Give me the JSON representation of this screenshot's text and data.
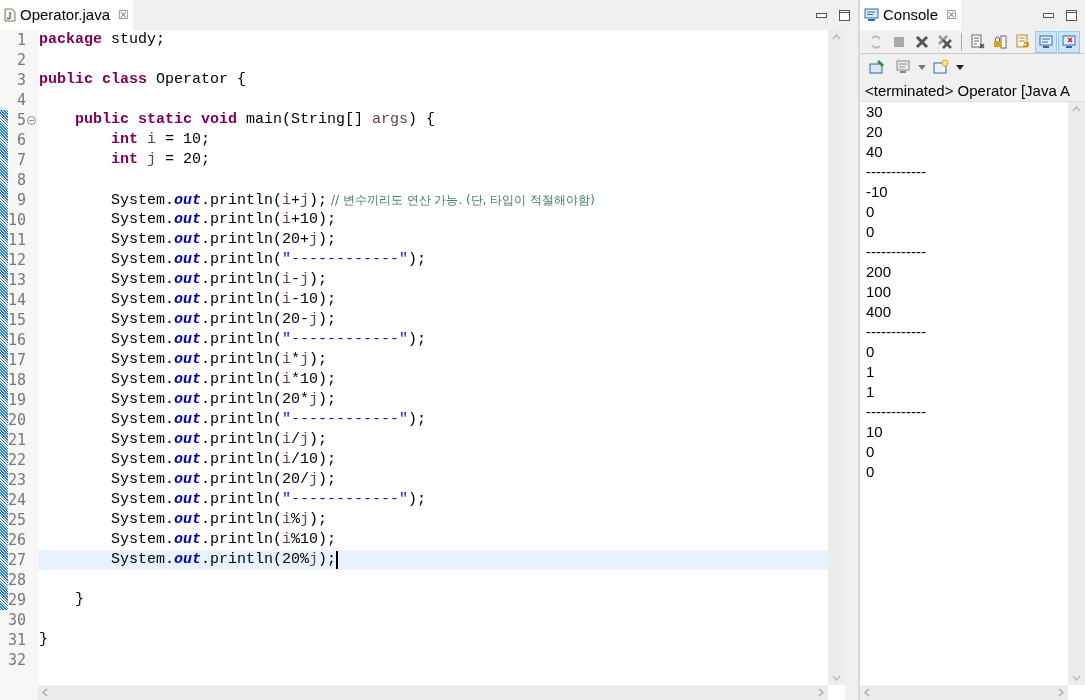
{
  "editor": {
    "tab": {
      "title": "Operator.java",
      "close": "☒",
      "selected": true
    },
    "lines": [
      {
        "number": "1",
        "changed": false,
        "current": false,
        "fold": false,
        "tokens": [
          {
            "kind": "keyword",
            "text": "package"
          },
          {
            "kind": "plain",
            "text": " study;"
          }
        ]
      },
      {
        "number": "2",
        "changed": false,
        "current": false,
        "fold": false
      },
      {
        "number": "3",
        "changed": false,
        "current": false,
        "fold": false,
        "tokens": [
          {
            "kind": "keyword",
            "text": "public class"
          },
          {
            "kind": "plain",
            "text": " Operator {"
          }
        ]
      },
      {
        "number": "4",
        "changed": false,
        "current": false,
        "fold": false
      },
      {
        "number": "5",
        "changed": true,
        "current": false,
        "fold": true,
        "tokens": [
          {
            "kind": "keyword",
            "text": "    public static void"
          },
          {
            "kind": "plain",
            "text": " main(String[] "
          },
          {
            "kind": "variable",
            "text": "args"
          },
          {
            "kind": "plain",
            "text": ") {"
          }
        ]
      },
      {
        "number": "6",
        "changed": true,
        "current": false,
        "fold": false,
        "tokens": [
          {
            "kind": "keyword",
            "text": "        int"
          },
          {
            "kind": "variable",
            "text": " i"
          },
          {
            "kind": "plain",
            "text": " = 10;"
          }
        ]
      },
      {
        "number": "7",
        "changed": true,
        "current": false,
        "fold": false,
        "tokens": [
          {
            "kind": "keyword",
            "text": "        int"
          },
          {
            "kind": "variable",
            "text": " j"
          },
          {
            "kind": "plain",
            "text": " = 20;"
          }
        ]
      },
      {
        "number": "8",
        "changed": true,
        "current": false,
        "fold": false
      },
      {
        "number": "9",
        "changed": true,
        "current": false,
        "fold": false,
        "tokens": [
          {
            "kind": "plain",
            "text": "        System."
          },
          {
            "kind": "field",
            "text": "out"
          },
          {
            "kind": "plain",
            "text": ".println("
          },
          {
            "kind": "variable",
            "text": "i"
          },
          {
            "kind": "plain",
            "text": "+"
          },
          {
            "kind": "variable",
            "text": "j"
          },
          {
            "kind": "plain",
            "text": ");"
          },
          {
            "kind": "comment",
            "text": " // 변수끼리도 연산 가능. (단, 타입이 적절해야함)"
          }
        ]
      },
      {
        "number": "10",
        "changed": true,
        "current": false,
        "fold": false,
        "tokens": [
          {
            "kind": "plain",
            "text": "        System."
          },
          {
            "kind": "field",
            "text": "out"
          },
          {
            "kind": "plain",
            "text": ".println("
          },
          {
            "kind": "variable",
            "text": "i"
          },
          {
            "kind": "plain",
            "text": "+10);"
          }
        ]
      },
      {
        "number": "11",
        "changed": true,
        "current": false,
        "fold": false,
        "tokens": [
          {
            "kind": "plain",
            "text": "        System."
          },
          {
            "kind": "field",
            "text": "out"
          },
          {
            "kind": "plain",
            "text": ".println(20+"
          },
          {
            "kind": "variable",
            "text": "j"
          },
          {
            "kind": "plain",
            "text": ");"
          }
        ]
      },
      {
        "number": "12",
        "changed": true,
        "current": false,
        "fold": false,
        "tokens": [
          {
            "kind": "plain",
            "text": "        System."
          },
          {
            "kind": "field",
            "text": "out"
          },
          {
            "kind": "plain",
            "text": ".println("
          },
          {
            "kind": "string",
            "text": "\"------------\""
          },
          {
            "kind": "plain",
            "text": ");"
          }
        ]
      },
      {
        "number": "13",
        "changed": true,
        "current": false,
        "fold": false,
        "tokens": [
          {
            "kind": "plain",
            "text": "        System."
          },
          {
            "kind": "field",
            "text": "out"
          },
          {
            "kind": "plain",
            "text": ".println("
          },
          {
            "kind": "variable",
            "text": "i"
          },
          {
            "kind": "plain",
            "text": "-"
          },
          {
            "kind": "variable",
            "text": "j"
          },
          {
            "kind": "plain",
            "text": ");"
          }
        ]
      },
      {
        "number": "14",
        "changed": true,
        "current": false,
        "fold": false,
        "tokens": [
          {
            "kind": "plain",
            "text": "        System."
          },
          {
            "kind": "field",
            "text": "out"
          },
          {
            "kind": "plain",
            "text": ".println("
          },
          {
            "kind": "variable",
            "text": "i"
          },
          {
            "kind": "plain",
            "text": "-10);"
          }
        ]
      },
      {
        "number": "15",
        "changed": true,
        "current": false,
        "fold": false,
        "tokens": [
          {
            "kind": "plain",
            "text": "        System."
          },
          {
            "kind": "field",
            "text": "out"
          },
          {
            "kind": "plain",
            "text": ".println(20-"
          },
          {
            "kind": "variable",
            "text": "j"
          },
          {
            "kind": "plain",
            "text": ");"
          }
        ]
      },
      {
        "number": "16",
        "changed": true,
        "current": false,
        "fold": false,
        "tokens": [
          {
            "kind": "plain",
            "text": "        System."
          },
          {
            "kind": "field",
            "text": "out"
          },
          {
            "kind": "plain",
            "text": ".println("
          },
          {
            "kind": "string",
            "text": "\"------------\""
          },
          {
            "kind": "plain",
            "text": ");"
          }
        ]
      },
      {
        "number": "17",
        "changed": true,
        "current": false,
        "fold": false,
        "tokens": [
          {
            "kind": "plain",
            "text": "        System."
          },
          {
            "kind": "field",
            "text": "out"
          },
          {
            "kind": "plain",
            "text": ".println("
          },
          {
            "kind": "variable",
            "text": "i"
          },
          {
            "kind": "plain",
            "text": "*"
          },
          {
            "kind": "variable",
            "text": "j"
          },
          {
            "kind": "plain",
            "text": ");"
          }
        ]
      },
      {
        "number": "18",
        "changed": true,
        "current": false,
        "fold": false,
        "tokens": [
          {
            "kind": "plain",
            "text": "        System."
          },
          {
            "kind": "field",
            "text": "out"
          },
          {
            "kind": "plain",
            "text": ".println("
          },
          {
            "kind": "variable",
            "text": "i"
          },
          {
            "kind": "plain",
            "text": "*10);"
          }
        ]
      },
      {
        "number": "19",
        "changed": true,
        "current": false,
        "fold": false,
        "tokens": [
          {
            "kind": "plain",
            "text": "        System."
          },
          {
            "kind": "field",
            "text": "out"
          },
          {
            "kind": "plain",
            "text": ".println(20*"
          },
          {
            "kind": "variable",
            "text": "j"
          },
          {
            "kind": "plain",
            "text": ");"
          }
        ]
      },
      {
        "number": "20",
        "changed": true,
        "current": false,
        "fold": false,
        "tokens": [
          {
            "kind": "plain",
            "text": "        System."
          },
          {
            "kind": "field",
            "text": "out"
          },
          {
            "kind": "plain",
            "text": ".println("
          },
          {
            "kind": "string",
            "text": "\"------------\""
          },
          {
            "kind": "plain",
            "text": ");"
          }
        ]
      },
      {
        "number": "21",
        "changed": true,
        "current": false,
        "fold": false,
        "tokens": [
          {
            "kind": "plain",
            "text": "        System."
          },
          {
            "kind": "field",
            "text": "out"
          },
          {
            "kind": "plain",
            "text": ".println("
          },
          {
            "kind": "variable",
            "text": "i"
          },
          {
            "kind": "plain",
            "text": "/"
          },
          {
            "kind": "variable",
            "text": "j"
          },
          {
            "kind": "plain",
            "text": ");"
          }
        ]
      },
      {
        "number": "22",
        "changed": true,
        "current": false,
        "fold": false,
        "tokens": [
          {
            "kind": "plain",
            "text": "        System."
          },
          {
            "kind": "field",
            "text": "out"
          },
          {
            "kind": "plain",
            "text": ".println("
          },
          {
            "kind": "variable",
            "text": "i"
          },
          {
            "kind": "plain",
            "text": "/10);"
          }
        ]
      },
      {
        "number": "23",
        "changed": true,
        "current": false,
        "fold": false,
        "tokens": [
          {
            "kind": "plain",
            "text": "        System."
          },
          {
            "kind": "field",
            "text": "out"
          },
          {
            "kind": "plain",
            "text": ".println(20/"
          },
          {
            "kind": "variable",
            "text": "j"
          },
          {
            "kind": "plain",
            "text": ");"
          }
        ]
      },
      {
        "number": "24",
        "changed": true,
        "current": false,
        "fold": false,
        "tokens": [
          {
            "kind": "plain",
            "text": "        System."
          },
          {
            "kind": "field",
            "text": "out"
          },
          {
            "kind": "plain",
            "text": ".println("
          },
          {
            "kind": "string",
            "text": "\"------------\""
          },
          {
            "kind": "plain",
            "text": ");"
          }
        ]
      },
      {
        "number": "25",
        "changed": true,
        "current": false,
        "fold": false,
        "tokens": [
          {
            "kind": "plain",
            "text": "        System."
          },
          {
            "kind": "field",
            "text": "out"
          },
          {
            "kind": "plain",
            "text": ".println("
          },
          {
            "kind": "variable",
            "text": "i"
          },
          {
            "kind": "plain",
            "text": "%"
          },
          {
            "kind": "variable",
            "text": "j"
          },
          {
            "kind": "plain",
            "text": ");"
          }
        ]
      },
      {
        "number": "26",
        "changed": true,
        "current": false,
        "fold": false,
        "tokens": [
          {
            "kind": "plain",
            "text": "        System."
          },
          {
            "kind": "field",
            "text": "out"
          },
          {
            "kind": "plain",
            "text": ".println("
          },
          {
            "kind": "variable",
            "text": "i"
          },
          {
            "kind": "plain",
            "text": "%10);"
          }
        ]
      },
      {
        "number": "27",
        "changed": true,
        "current": true,
        "fold": false,
        "tokens": [
          {
            "kind": "plain",
            "text": "        System."
          },
          {
            "kind": "field",
            "text": "out"
          },
          {
            "kind": "plain",
            "text": ".println(20%"
          },
          {
            "kind": "variable",
            "text": "j"
          },
          {
            "kind": "plain",
            "text": ");"
          }
        ]
      },
      {
        "number": "28",
        "changed": true,
        "current": false,
        "fold": false
      },
      {
        "number": "29",
        "changed": true,
        "current": false,
        "fold": false,
        "tokens": [
          {
            "kind": "plain",
            "text": "    }"
          }
        ]
      },
      {
        "number": "30",
        "changed": false,
        "current": false,
        "fold": false
      },
      {
        "number": "31",
        "changed": false,
        "current": false,
        "fold": false,
        "tokens": [
          {
            "kind": "plain",
            "text": "}"
          }
        ]
      },
      {
        "number": "32",
        "changed": false,
        "current": false,
        "fold": false
      }
    ]
  },
  "console": {
    "tab": {
      "title": "Console",
      "close": "☒",
      "selected": true
    },
    "status": "<terminated> Operator [Java A",
    "output": [
      "30",
      "20",
      "40",
      "------------",
      "-10",
      "0",
      "0",
      "------------",
      "200",
      "100",
      "400",
      "------------",
      "0",
      "1",
      "1",
      "------------",
      "10",
      "0",
      "0"
    ]
  }
}
